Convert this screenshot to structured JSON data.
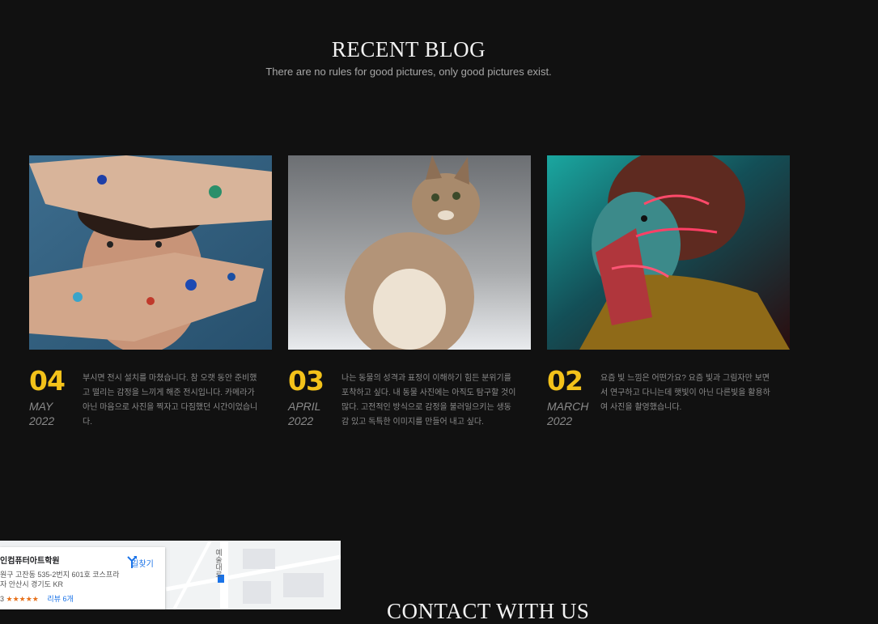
{
  "blog": {
    "title": "RECENT BLOG",
    "subtitle": "There are no rules for good pictures, only good pictures exist.",
    "posts": [
      {
        "image": "painted-hands-photo",
        "day": "04",
        "month": "MAY",
        "year": "2022",
        "excerpt": "부시면 전시 설치를 마쳤습니다. 참 오랫 동안 준비했고 떨리는 감정을 느끼게 해준 전시입니다. 카메라가 아닌 마음으로 사진을 찍자고 다짐했던 시간이었습니다."
      },
      {
        "image": "cat-photo",
        "day": "03",
        "month": "APRIL",
        "year": "2022",
        "excerpt": "나는 동물의 성격과 표정이 이해하기 힘든 분위기를 포착하고 싶다. 내 동물 사진에는 아직도 탐구할 것이 많다. 고전적인 방식으로 감정을 불러일으키는 생동감 있고 독특한 이미지를 만들어 내고 싶다."
      },
      {
        "image": "neon-portrait-photo",
        "day": "02",
        "month": "MARCH",
        "year": "2022",
        "excerpt": "요즘 빛 느낌은 어떤가요? 요즘 빛과 그림자만 보면서 연구하고 다니는데 햇빛이 아닌 다른빛을 활용하여 사진을 촬영했습니다."
      }
    ]
  },
  "map": {
    "place_name": "인컴퓨터아트학원",
    "address": "원구 고잔동 535-2번지 601호 코스프라자 안산시 경기도 KR",
    "rating_value": "3",
    "stars": "★★★★★",
    "reviews": "리뷰 6개",
    "directions": "길찾기",
    "road_label": "예술대로"
  },
  "contact": {
    "title": "CONTACT WITH US"
  },
  "colors": {
    "background": "#111111",
    "accent": "#f3c21a"
  }
}
